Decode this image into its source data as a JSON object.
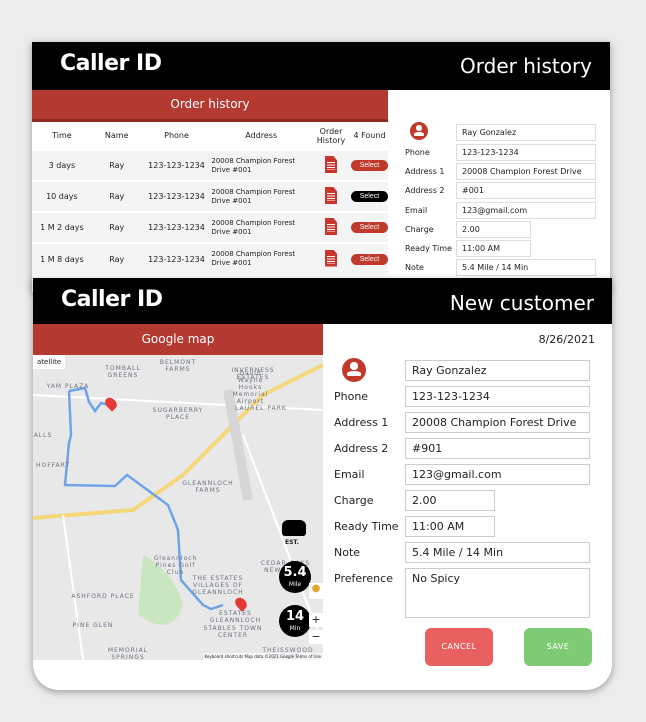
{
  "history_window": {
    "logo": "Caller ID",
    "title": "Order history",
    "section": "Order history",
    "columns": [
      "Time",
      "Name",
      "Phone",
      "Address",
      "Order History",
      "4 Found"
    ],
    "rows": [
      {
        "time": "3 days",
        "name": "Ray",
        "phone": "123-123-1234",
        "address": "20008 Champion Forest Drive #001",
        "select": "Select",
        "active": false
      },
      {
        "time": "10 days",
        "name": "Ray",
        "phone": "123-123-1234",
        "address": "20008 Champion Forest Drive #001",
        "select": "Select",
        "active": true
      },
      {
        "time": "1 M 2 days",
        "name": "Ray",
        "phone": "123-123-1234",
        "address": "20008 Champion Forest Drive #001",
        "select": "Select",
        "active": false
      },
      {
        "time": "1 M 8 days",
        "name": "Ray",
        "phone": "123-123-1234",
        "address": "20008 Champion Forest Drive #001",
        "select": "Select",
        "active": false
      }
    ],
    "form": {
      "name": "Ray Gonzalez",
      "labels": {
        "phone": "Phone",
        "address1": "Address 1",
        "address2": "Address 2",
        "email": "Email",
        "charge": "Charge",
        "ready": "Ready Time",
        "note": "Note"
      },
      "phone": "123-123-1234",
      "address1": "20008 Champion Forest Drive",
      "address2": "#001",
      "email": "123@gmail.com",
      "charge": "2.00",
      "ready": "11:00 AM",
      "note": "5.4  Mile  / 14 Min"
    }
  },
  "customer_window": {
    "logo": "Caller ID",
    "title": "New customer",
    "section": "Google map",
    "date": "8/26/2021",
    "form": {
      "name": "Ray Gonzalez",
      "labels": {
        "phone": "Phone",
        "address1": "Address 1",
        "address2": "Address 2",
        "email": "Email",
        "charge": "Charge",
        "ready": "Ready Time",
        "note": "Note",
        "preference": "Preference"
      },
      "phone": "123-123-1234",
      "address1": "20008 Champion Forest Drive",
      "address2": "#901",
      "email": "123@gmail.com",
      "charge": "2.00",
      "ready": "11:00 AM",
      "note": "5.4  Mile  / 14 Min",
      "preference": "No Spicy"
    },
    "cancel": "CANCEL",
    "save": "SAVE",
    "map": {
      "satellite": "atellite",
      "est": "EST.",
      "distance": "5.4",
      "distance_unit": "Mile",
      "time": "14",
      "time_unit": "Min",
      "zoom_in": "+",
      "zoom_out": "−",
      "footer": "Keyboard shortcuts   Map data ©2021 Google   Terms of Use",
      "marker_a": "A",
      "marker_b": "B",
      "labels": [
        "BELMONT FARMS",
        "TOMBALL GREENS",
        "INVERNESS ESTATES",
        "David Wayne Hooks Memorial Airport",
        "YAM PLAZA",
        "SUGARBERRY PLACE",
        "LAUREL PARK",
        "ALLS",
        "HOFFART",
        "GLEANNLOCH FARMS",
        "Gleannloch Pines Golf Club",
        "CEDAR OAKS NEW DAWN",
        "THE ESTATES VILLAGES OF GLEANNLOCH",
        "ASHFORD PLACE",
        "ESTATES GLEANNLOCH",
        "STABLES TOWN CENTER",
        "PINE GLEN",
        "MEMORIAL SPRINGS",
        "THEISSWOOD ESTATES"
      ]
    }
  },
  "colors": {
    "accent": "#b43a31",
    "cancel": "#e8605f",
    "save": "#7fca74",
    "route": "#6fa3e8",
    "road": "#f5d77a"
  }
}
